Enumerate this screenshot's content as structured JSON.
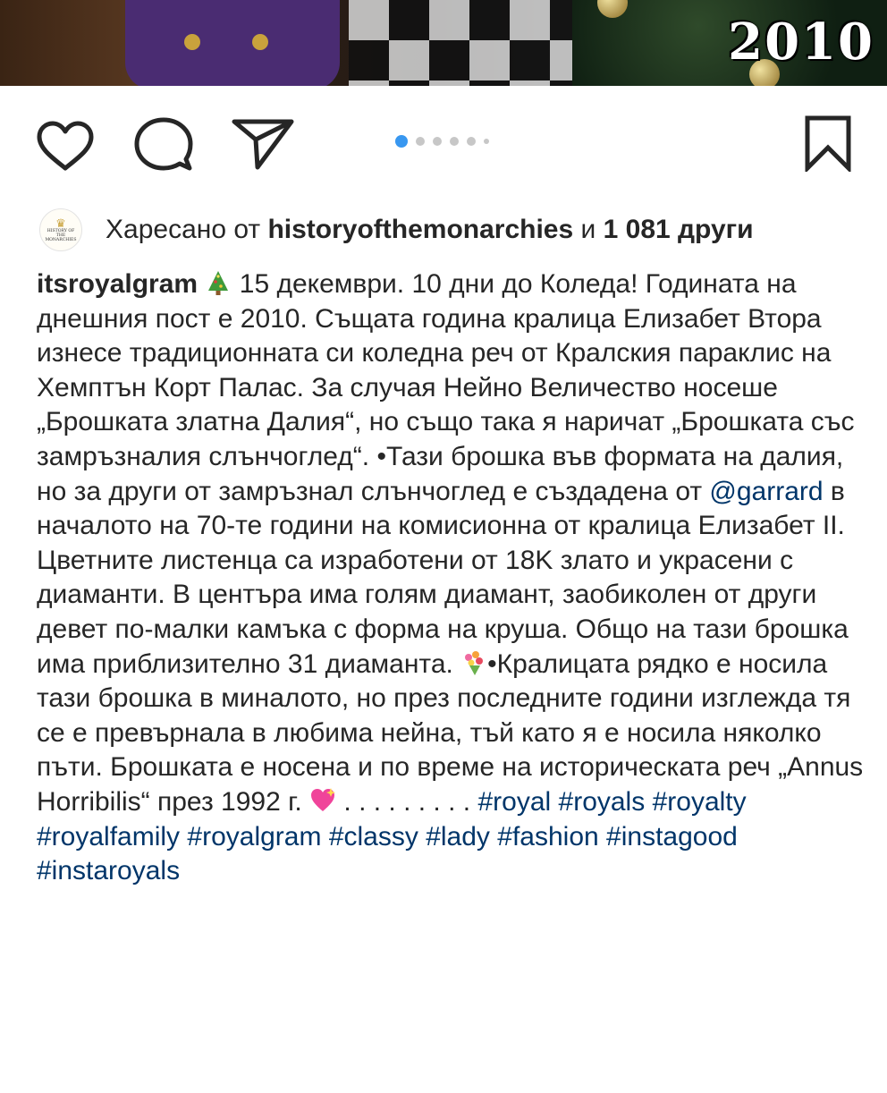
{
  "photo": {
    "year_text": "2010"
  },
  "actions": {
    "like_icon": "heart-outline-icon",
    "comment_icon": "comment-bubble-icon",
    "share_icon": "paper-plane-icon",
    "save_icon": "bookmark-outline-icon",
    "carousel": {
      "total_dots": 6,
      "active_index": 0
    }
  },
  "likes": {
    "avatar_text_line1": "HISTORY OF",
    "avatar_text_line2": "THE",
    "avatar_text_line3": "MONARCHIES",
    "prefix": "Харесано от ",
    "user": "historyofthemonarchies",
    "middle": " и ",
    "count": "1 081 други"
  },
  "caption": {
    "username": "itsroyalgram",
    "p1": " 15 декември. 10 дни до Коледа! Годината на днешния пост е 2010. Същата година кралица Елизабет Втора изнесе традиционната си коледна реч от Кралския параклис на Хемптън Корт Палас. За случая Нейно Величество носеше „Брошката златна Далия“, но също така я наричат „Брошката със замръзналия слънчоглед“. •Тази брошка във формата на далия, но за други от замръзнал слънчоглед е създадена от ",
    "mention": "@garrard",
    "p2": " в началото на 70-те години на комисионна от кралица Елизабет II. Цветните листенца са изработени от 18K злато и украсени с диаманти. В центъра има голям диамант, заобиколен от други девет по-малки камъка с форма на круша. Общо на тази брошка има приблизително 31 диаманта. ",
    "p3": "•Кралицата рядко е носила тази брошка в миналото, но през последните години изглежда тя се е превърнала в любима нейна, тъй като я е носила няколко пъти. Брошката е носена и по време на историческата реч „Annus Horribilis“ през 1992 г. ",
    "p4": " . . . . . . . . . ",
    "hashtags": [
      "#royal",
      "#royals",
      "#royalty",
      "#royalfamily",
      "#royalgram",
      "#classy",
      "#lady",
      "#fashion",
      "#instagood",
      "#instaroyals"
    ],
    "emojis": [
      "christmas-tree-emoji",
      "bouquet-emoji",
      "sparkling-heart-emoji"
    ]
  },
  "colors": {
    "link": "#003569",
    "active_dot": "#3897f0",
    "text": "#262626"
  }
}
